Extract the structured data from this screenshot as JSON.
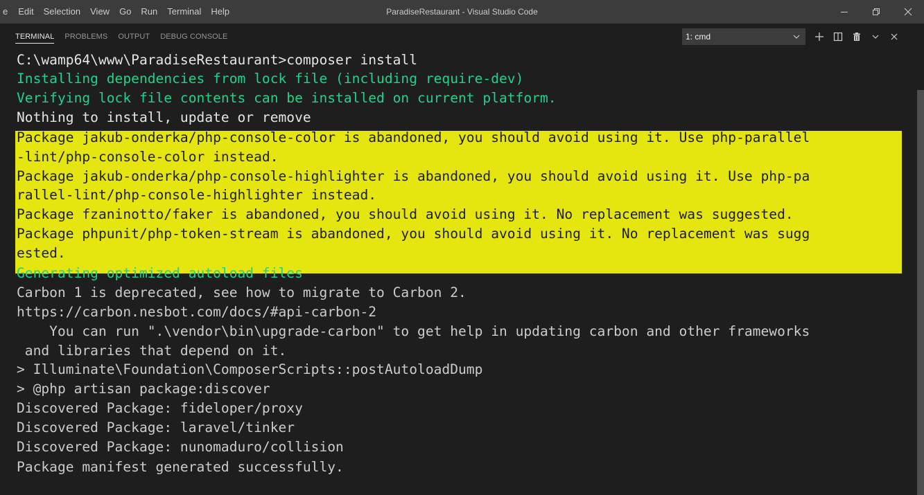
{
  "menu": {
    "items": [
      "e",
      "Edit",
      "Selection",
      "View",
      "Go",
      "Run",
      "Terminal",
      "Help"
    ]
  },
  "window": {
    "title": "ParadiseRestaurant - Visual Studio Code"
  },
  "panel": {
    "tabs": [
      "TERMINAL",
      "PROBLEMS",
      "OUTPUT",
      "DEBUG CONSOLE"
    ],
    "active_tab": "TERMINAL",
    "terminal_selector": "1: cmd"
  },
  "icons": {
    "minimize": "minimize-icon",
    "restore": "restore-icon",
    "close": "close-icon",
    "new_terminal": "plus-icon",
    "split": "split-icon",
    "kill": "trash-icon",
    "maximize_panel": "chevron-up-icon",
    "close_panel": "close-icon"
  },
  "colors": {
    "success_text": "#23d18b",
    "warning_background": "#e5e510",
    "default_text": "#cccccc"
  },
  "terminal": {
    "lines": [
      {
        "text": "C:\\wamp64\\www\\ParadiseRestaurant>composer install",
        "style": "white"
      },
      {
        "text": "Installing dependencies from lock file (including require-dev)",
        "style": "green"
      },
      {
        "text": "Verifying lock file contents can be installed on current platform.",
        "style": "green"
      },
      {
        "text": "Nothing to install, update or remove",
        "style": "white"
      },
      {
        "text": "Package jakub-onderka/php-console-color is abandoned, you should avoid using it. Use php-parallel",
        "style": "warn"
      },
      {
        "text": "-lint/php-console-color instead.",
        "style": "warn"
      },
      {
        "text": "Package jakub-onderka/php-console-highlighter is abandoned, you should avoid using it. Use php-pa",
        "style": "warn"
      },
      {
        "text": "rallel-lint/php-console-highlighter instead.",
        "style": "warn"
      },
      {
        "text": "Package fzaninotto/faker is abandoned, you should avoid using it. No replacement was suggested.",
        "style": "warn"
      },
      {
        "text": "Package phpunit/php-token-stream is abandoned, you should avoid using it. No replacement was sugg",
        "style": "warn"
      },
      {
        "text": "ested.",
        "style": "warn"
      },
      {
        "text": "Generating optimized autoload files",
        "style": "green"
      },
      {
        "text": "Carbon 1 is deprecated, see how to migrate to Carbon 2.",
        "style": "normal"
      },
      {
        "text": "https://carbon.nesbot.com/docs/#api-carbon-2",
        "style": "normal"
      },
      {
        "text": "    You can run \".\\vendor\\bin\\upgrade-carbon\" to get help in updating carbon and other frameworks",
        "style": "normal"
      },
      {
        "text": " and libraries that depend on it.",
        "style": "normal"
      },
      {
        "text": "> Illuminate\\Foundation\\ComposerScripts::postAutoloadDump",
        "style": "normal"
      },
      {
        "text": "> @php artisan package:discover",
        "style": "normal"
      },
      {
        "text": "Discovered Package: fideloper/proxy",
        "style": "normal"
      },
      {
        "text": "Discovered Package: laravel/tinker",
        "style": "normal"
      },
      {
        "text": "Discovered Package: nunomaduro/collision",
        "style": "normal"
      },
      {
        "text": "Package manifest generated successfully.",
        "style": "normal"
      }
    ]
  }
}
